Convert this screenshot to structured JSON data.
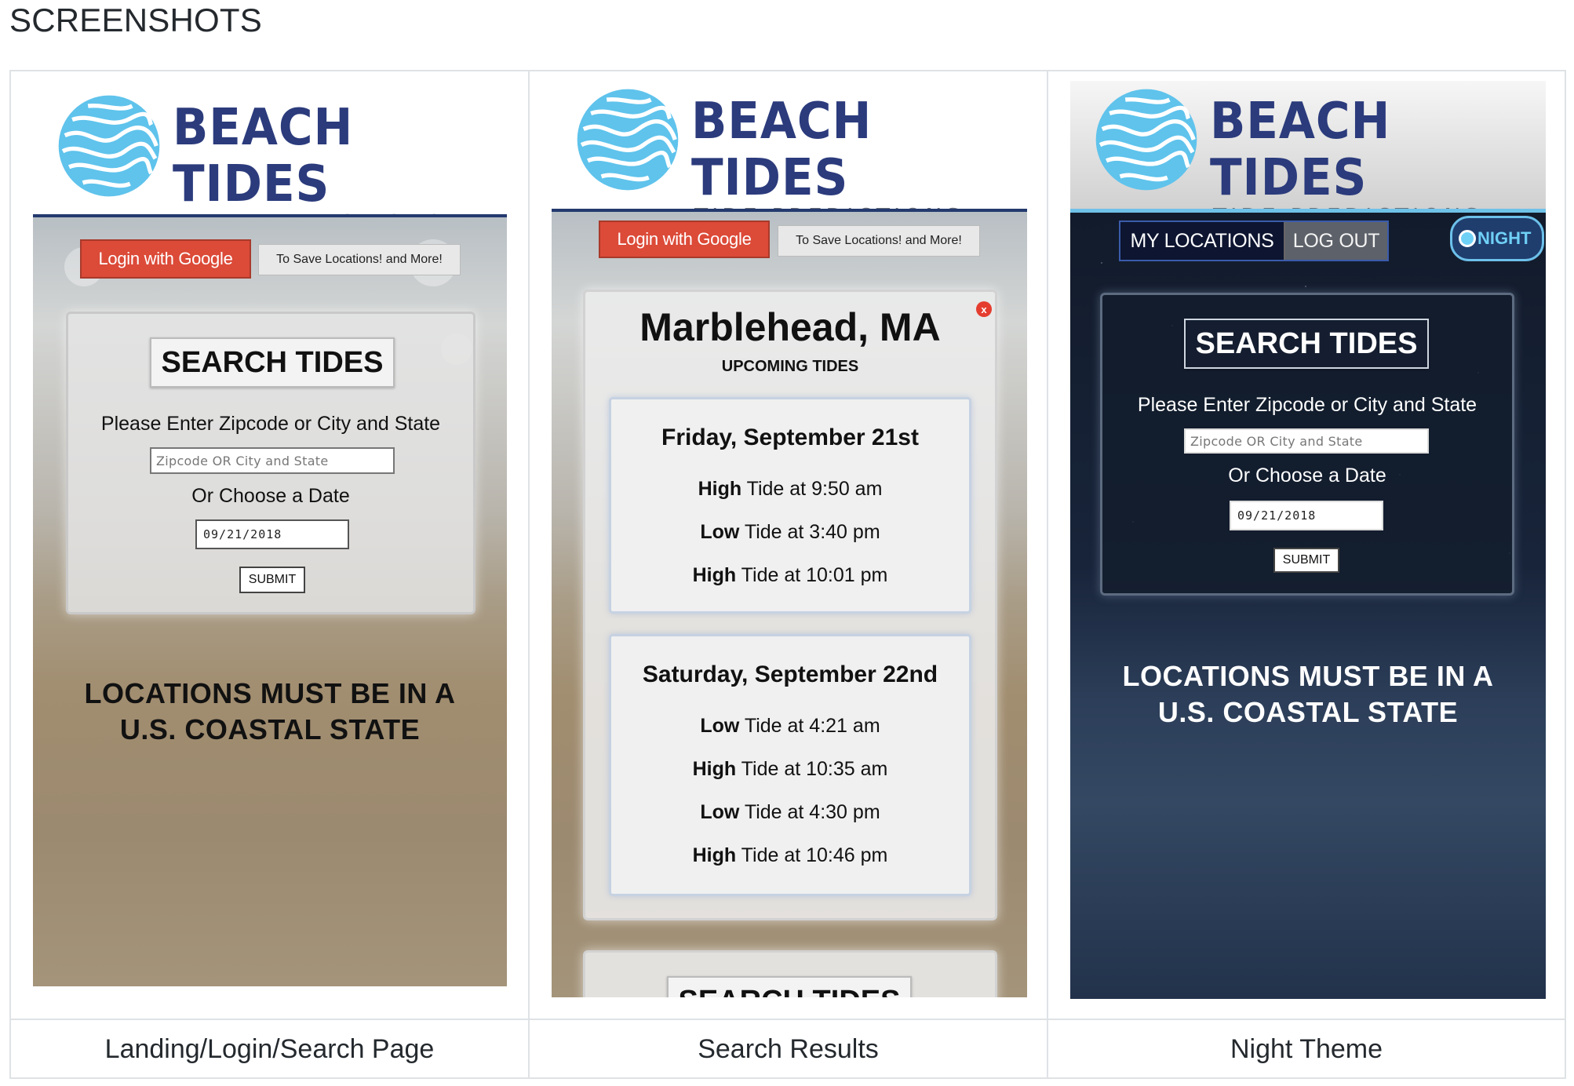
{
  "section_heading": "SCREENSHOTS",
  "logo": {
    "title": "BEACH TIDES",
    "subtitle": "TIDE PREDICTIONS"
  },
  "colors": {
    "brand_navy": "#2b3b7c",
    "google_red": "#dc4a38",
    "night_accent": "#6fc2e8",
    "logo_swirl": "#5fc3ec"
  },
  "landing": {
    "login_button": "Login with Google",
    "login_note": "To Save Locations! and More!",
    "search_title": "SEARCH TIDES",
    "zip_prompt": "Please Enter Zipcode or City and State",
    "zip_placeholder": "Zipcode OR City and State",
    "date_prompt": "Or Choose a Date",
    "date_value": "09/21/2018",
    "submit": "SUBMIT",
    "notice_line1": "LOCATIONS MUST BE IN A",
    "notice_line2": "U.S. COASTAL STATE"
  },
  "results": {
    "login_button": "Login with Google",
    "login_note": "To Save Locations! and More!",
    "close": "x",
    "city": "Marblehead, MA",
    "subtitle": "UPCOMING TIDES",
    "days": [
      {
        "title": "Friday, September 21st",
        "tides": [
          {
            "type": "High",
            "text": "Tide at 9:50 am"
          },
          {
            "type": "Low",
            "text": "Tide at 3:40 pm"
          },
          {
            "type": "High",
            "text": "Tide at 10:01 pm"
          }
        ]
      },
      {
        "title": "Saturday, September 22nd",
        "tides": [
          {
            "type": "Low",
            "text": "Tide at 4:21 am"
          },
          {
            "type": "High",
            "text": "Tide at 10:35 am"
          },
          {
            "type": "Low",
            "text": "Tide at 4:30 pm"
          },
          {
            "type": "High",
            "text": "Tide at 10:46 pm"
          }
        ]
      }
    ],
    "peek_title": "SEARCH TIDES"
  },
  "night": {
    "my_locations": "MY LOCATIONS",
    "log_out": "LOG OUT",
    "toggle_label": "NIGHT",
    "search_title": "SEARCH TIDES",
    "zip_prompt": "Please Enter Zipcode or City and State",
    "zip_placeholder": "Zipcode OR City and State",
    "date_prompt": "Or Choose a Date",
    "date_value": "09/21/2018",
    "submit": "SUBMIT",
    "notice_line1": "LOCATIONS MUST BE IN A",
    "notice_line2": "U.S. COASTAL STATE"
  },
  "captions": [
    "Landing/Login/Search Page",
    "Search Results",
    "Night Theme"
  ],
  "icons": {
    "logo": "wave-swirl-icon",
    "toggle": "night-toggle-knob-icon",
    "close": "close-icon"
  }
}
